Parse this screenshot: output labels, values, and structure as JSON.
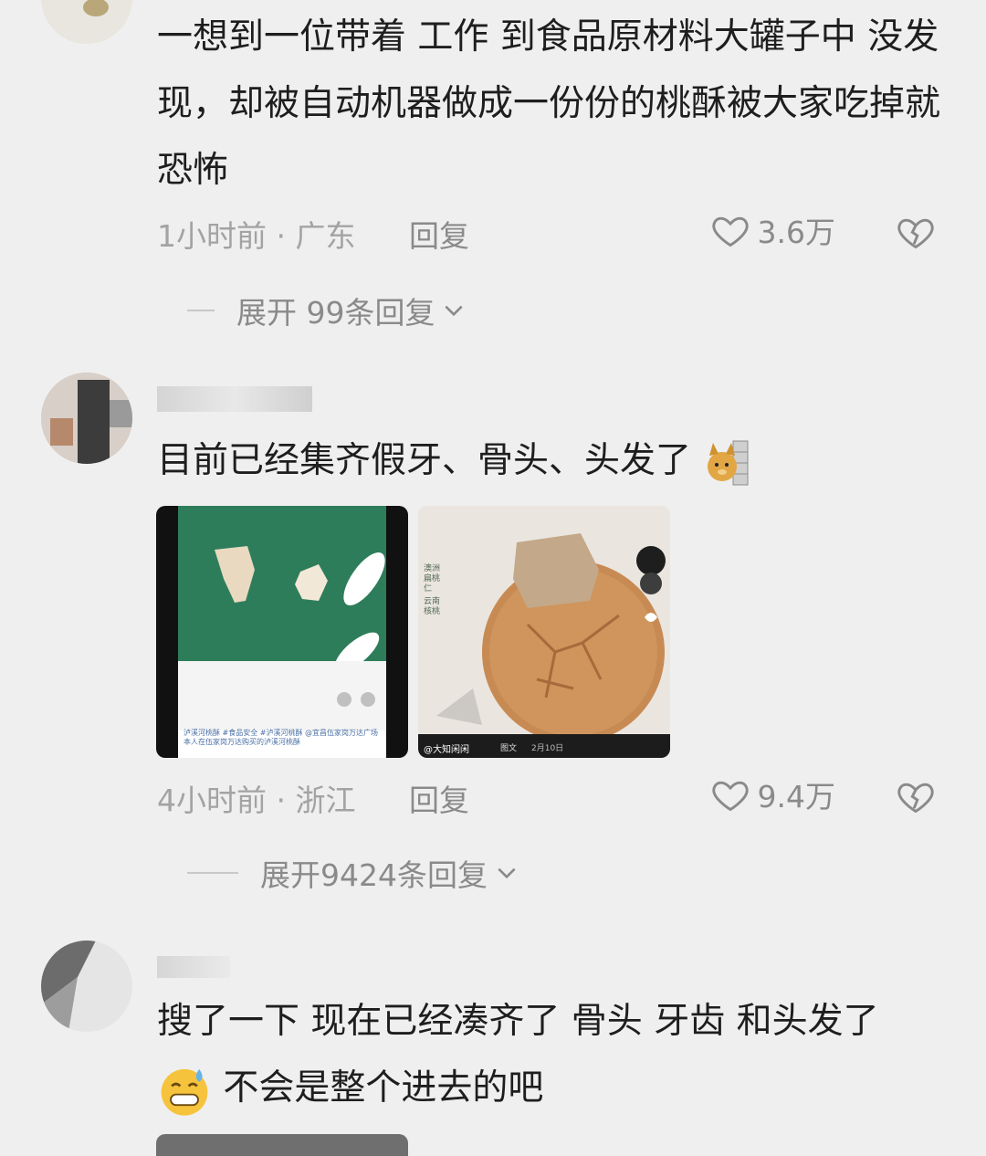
{
  "comments": [
    {
      "text": "一想到一位带着 工作 到食品原材料大罐子中 没发现，却被自动机器做成一份份的桃酥被大家吃掉就恐怖",
      "time": "1小时前",
      "location": "广东",
      "reply_label": "回复",
      "likes": "3.6万",
      "expand_label": "展开 99条回复"
    },
    {
      "username": "",
      "text": "目前已经集齐假牙、骨头、头发了",
      "time": "4小时前",
      "location": "浙江",
      "reply_label": "回复",
      "likes": "9.4万",
      "expand_label": "展开9424条回复",
      "images": [
        {
          "caption": "泸溪河桃酥 #食品安全 #泸溪河桃酥 @宜昌伍家岗万达广场 本人在伍家岗万达购买的泸溪河桃酥"
        },
        {
          "side_text_1": "澳洲扁桃仁",
          "side_text_2": "云南核桃",
          "user_tag": "@大知闲闲",
          "date": "2月10日",
          "tag": "图文"
        }
      ]
    },
    {
      "username": "",
      "text_line1": "搜了一下 现在已经凑齐了 骨头 牙齿 和头发了",
      "text_line2": "不会是整个进去的吧"
    }
  ],
  "colors": {
    "background": "#efefef",
    "text": "#1e1e1e",
    "meta": "#a3a3a3",
    "icon": "#8a8a8a"
  },
  "icons": [
    "heart-icon",
    "broken-heart-icon",
    "chevron-down-icon"
  ]
}
